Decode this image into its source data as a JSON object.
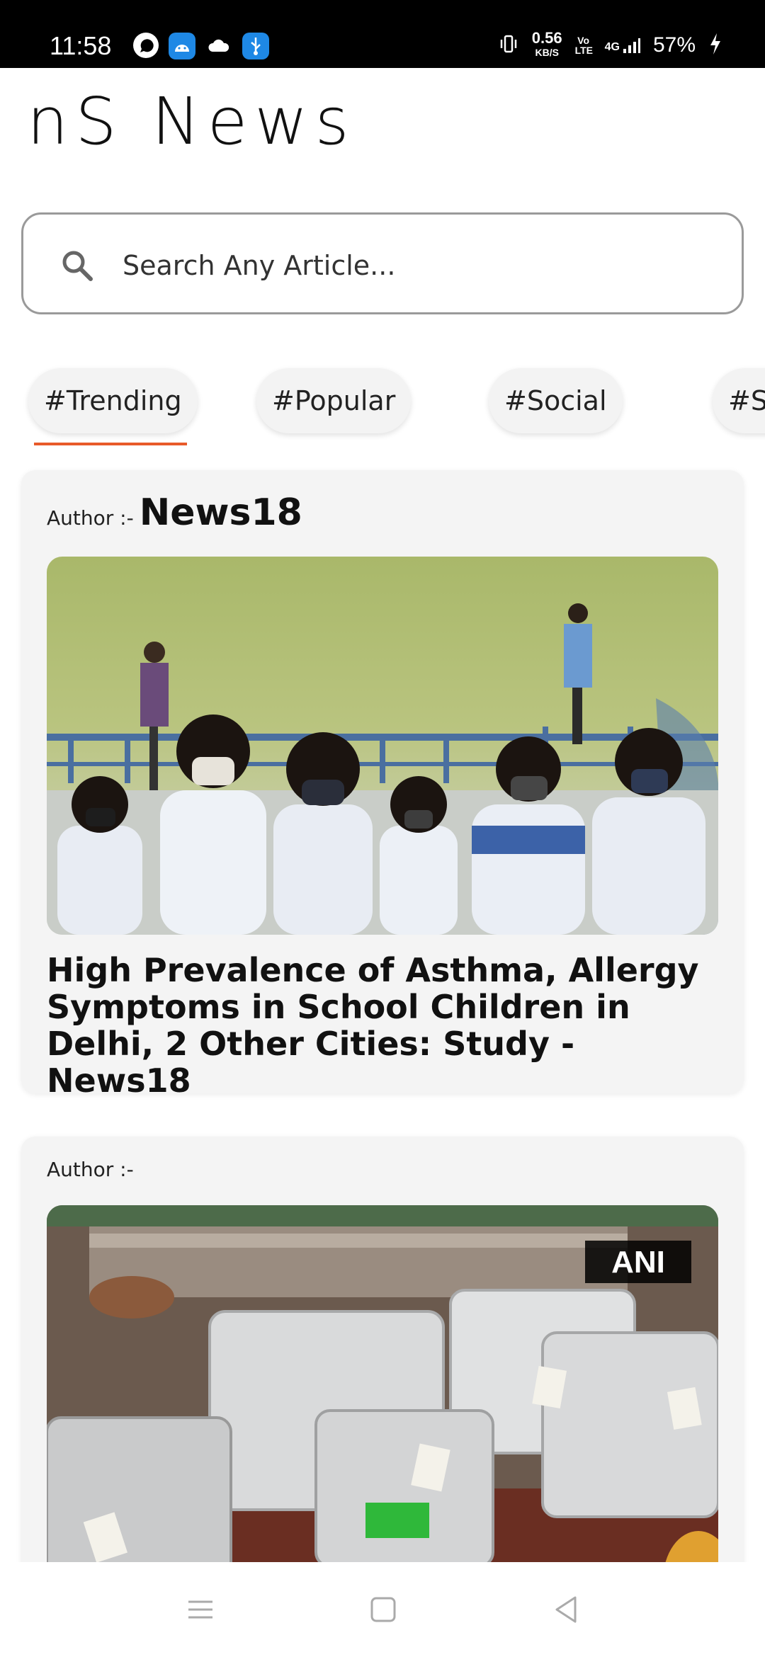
{
  "status_bar": {
    "time": "11:58",
    "network_speed": "0.56",
    "network_unit": "KB/S",
    "volte": "Vo LTE",
    "signal": "4G",
    "battery": "57%"
  },
  "app": {
    "title": "nS News"
  },
  "search": {
    "placeholder": "Search Any Article..."
  },
  "tabs": [
    {
      "label": "#Trending",
      "active": true
    },
    {
      "label": "#Popular"
    },
    {
      "label": "#Social"
    },
    {
      "label": "#Sp"
    }
  ],
  "articles": [
    {
      "author_label": "Author :-",
      "author": "News18",
      "image_description": "school children wearing masks",
      "headline": "High Prevalence of Asthma, Allergy Symptoms in School Children in Delhi, 2 Other Cities: Study - News18"
    },
    {
      "author_label": "Author :-",
      "author": "",
      "image_watermark": "ANI",
      "image_description": "voting machine cases on a table"
    }
  ],
  "colors": {
    "accent": "#e85a2a",
    "card_bg": "#f4f4f4"
  },
  "nav": {
    "icons": [
      "menu-icon",
      "home-square-icon",
      "back-triangle-icon"
    ]
  }
}
